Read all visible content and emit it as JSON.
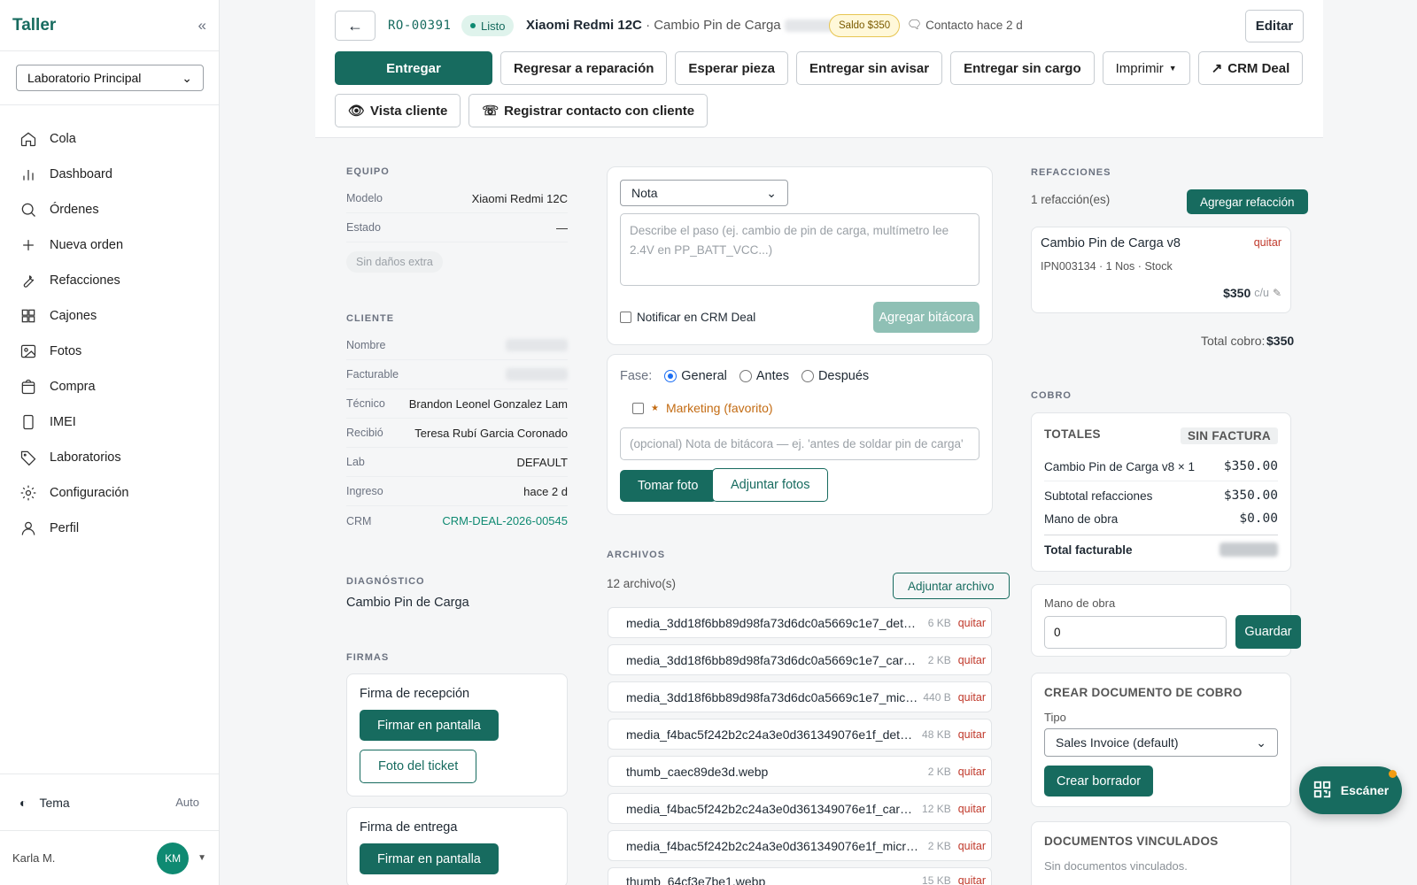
{
  "sidebar": {
    "brand": "Taller",
    "lab_select": "Laboratorio Principal",
    "items": [
      {
        "label": "Cola",
        "icon": "home-icon"
      },
      {
        "label": "Dashboard",
        "icon": "chart-icon"
      },
      {
        "label": "Órdenes",
        "icon": "search-icon"
      },
      {
        "label": "Nueva orden",
        "icon": "plus-icon"
      },
      {
        "label": "Refacciones",
        "icon": "wrench-icon"
      },
      {
        "label": "Cajones",
        "icon": "grid-icon"
      },
      {
        "label": "Fotos",
        "icon": "image-icon"
      },
      {
        "label": "Compra",
        "icon": "bag-icon"
      },
      {
        "label": "IMEI",
        "icon": "phone-icon"
      },
      {
        "label": "Laboratorios",
        "icon": "tag-icon"
      },
      {
        "label": "Configuración",
        "icon": "gear-icon"
      },
      {
        "label": "Perfil",
        "icon": "user-icon"
      }
    ],
    "theme_label": "Tema",
    "theme_value": "Auto",
    "user_name": "Karla M.",
    "user_initials": "KM"
  },
  "header": {
    "order_id": "RO-00391",
    "status": "Listo",
    "device": "Xiaomi Redmi 12C",
    "service": "· Cambio Pin de Carga",
    "saldo": "Saldo $350",
    "contacto": "Contacto hace 2 d",
    "edit": "Editar",
    "actions_row1": [
      "Entregar",
      "Regresar a reparación",
      "Esperar pieza",
      "Entregar sin avisar",
      "Entregar sin cargo",
      "Imprimir",
      "CRM Deal"
    ],
    "actions_row2": [
      "Vista cliente",
      "Registrar contacto con cliente"
    ]
  },
  "equipo": {
    "title": "EQUIPO",
    "rows": [
      {
        "k": "Modelo",
        "v": "Xiaomi Redmi 12C"
      },
      {
        "k": "Estado",
        "v": "—"
      }
    ],
    "chip": "Sin daños extra"
  },
  "cliente": {
    "title": "CLIENTE",
    "rows": [
      {
        "k": "Nombre",
        "v": ""
      },
      {
        "k": "Facturable",
        "v": ""
      },
      {
        "k": "Técnico",
        "v": "Brandon Leonel Gonzalez Lam"
      },
      {
        "k": "Recibió",
        "v": "Teresa Rubí Garcia Coronado"
      },
      {
        "k": "Lab",
        "v": "DEFAULT"
      },
      {
        "k": "Ingreso",
        "v": "hace 2 d"
      },
      {
        "k": "CRM",
        "v": "CRM-DEAL-2026-00545"
      }
    ]
  },
  "diagnostico": {
    "title": "DIAGNÓSTICO",
    "text": "Cambio Pin de Carga"
  },
  "firmas": {
    "title": "FIRMAS",
    "recepcion": "Firma de recepción",
    "firmar": "Firmar en pantalla",
    "foto_ticket": "Foto del ticket",
    "entrega": "Firma de entrega"
  },
  "bitacora": {
    "type": "Nota",
    "placeholder": "Describe el paso (ej. cambio de pin de carga, multímetro lee 2.4V en PP_BATT_VCC...)",
    "notify": "Notificar en CRM Deal",
    "add": "Agregar bitácora"
  },
  "fotos": {
    "fase_label": "Fase:",
    "fases": [
      "General",
      "Antes",
      "Después"
    ],
    "marketing": "Marketing (favorito)",
    "nota_placeholder": "(opcional) Nota de bitácora — ej. 'antes de soldar pin de carga'",
    "tomar": "Tomar foto",
    "adjuntar": "Adjuntar fotos"
  },
  "archivos": {
    "title": "ARCHIVOS",
    "count": "12 archivo(s)",
    "adjuntar": "Adjuntar archivo",
    "quitar": "quitar",
    "files": [
      {
        "name": "media_3dd18f6bb89d98fa73d6dc0a5669c1e7_detail.webp",
        "size": "6 KB"
      },
      {
        "name": "media_3dd18f6bb89d98fa73d6dc0a5669c1e7_card.webp",
        "size": "2 KB"
      },
      {
        "name": "media_3dd18f6bb89d98fa73d6dc0a5669c1e7_micro.webp",
        "size": "440 B"
      },
      {
        "name": "media_f4bac5f242b2c24a3e0d361349076e1f_detail.webp",
        "size": "48 KB"
      },
      {
        "name": "thumb_caec89de3d.webp",
        "size": "2 KB"
      },
      {
        "name": "media_f4bac5f242b2c24a3e0d361349076e1f_card.webp",
        "size": "12 KB"
      },
      {
        "name": "media_f4bac5f242b2c24a3e0d361349076e1f_micro.webp",
        "size": "2 KB"
      },
      {
        "name": "thumb_64cf3e7be1.webp",
        "size": "15 KB"
      }
    ]
  },
  "refacciones": {
    "title": "REFACCIONES",
    "count": "1 refacción(es)",
    "add": "Agregar refacción",
    "item_name": "Cambio Pin de Carga v8",
    "item_remove": "quitar",
    "item_meta": "IPN003134 · 1 Nos ·",
    "item_stock": "Stock",
    "item_price": "$350",
    "item_unit": "c/u",
    "total_label": "Total cobro:",
    "total_value": "$350"
  },
  "cobro": {
    "title": "COBRO",
    "totales": "TOTALES",
    "sin_factura": "SIN FACTURA",
    "line_label": "Cambio Pin de Carga v8 × 1",
    "line_value": "$350.00",
    "subtotal_label": "Subtotal refacciones",
    "subtotal_value": "$350.00",
    "mano_label": "Mano de obra",
    "mano_value": "$0.00",
    "total_label": "Total facturable",
    "mano_input_label": "Mano de obra",
    "mano_input_value": "0",
    "guardar": "Guardar",
    "crear_title": "CREAR DOCUMENTO DE COBRO",
    "tipo_label": "Tipo",
    "tipo_value": "Sales Invoice (default)",
    "crear_borrador": "Crear borrador",
    "vinc_title": "DOCUMENTOS VINCULADOS",
    "vinc_empty": "Sin documentos vinculados."
  },
  "fab": {
    "label": "Escáner"
  }
}
